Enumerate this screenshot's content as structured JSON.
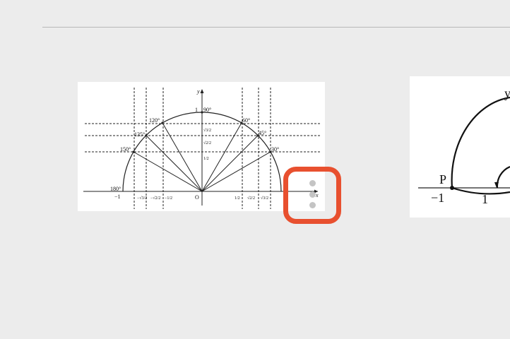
{
  "main_figure": {
    "axis_x": "x",
    "axis_y": "y",
    "origin": "O",
    "angle_labels": [
      "180°",
      "150°",
      "135°",
      "120°",
      "90°",
      "60°",
      "45°",
      "30°"
    ],
    "x_tick_labels": {
      "neg_one": "−1",
      "neg_sqrt3_2": "−√3/2",
      "neg_sqrt2_2": "−√2/2",
      "neg_half": "−1/2",
      "half": "1/2",
      "sqrt2_2": "√2/2",
      "sqrt3_2": "√3/2"
    },
    "y_tick_labels": {
      "one": "1",
      "sqrt3_2": "√3/2",
      "sqrt2_2": "√2/2",
      "half": "1/2"
    }
  },
  "side_figure": {
    "point_label": "P",
    "axis_y": "y",
    "neg_one": "−1",
    "one": "1"
  },
  "more_menu": {
    "icon": "more-vertical-icon",
    "highlight_color": "#e8502f"
  }
}
